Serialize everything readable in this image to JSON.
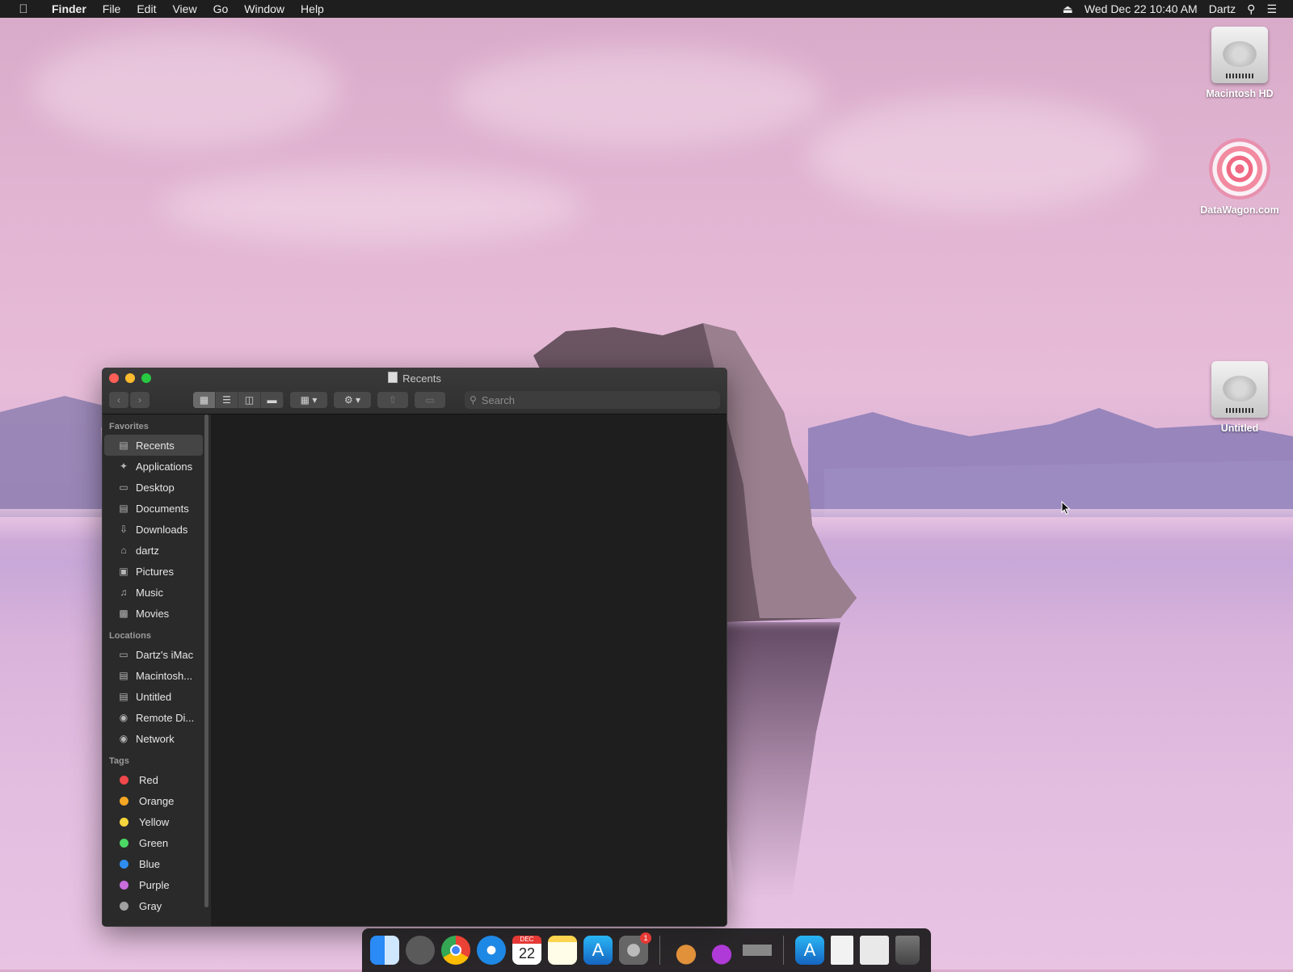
{
  "menubar": {
    "app": "Finder",
    "items": [
      "File",
      "Edit",
      "View",
      "Go",
      "Window",
      "Help"
    ],
    "datetime": "Wed Dec 22  10:40 AM",
    "user": "Dartz"
  },
  "desktop_icons": {
    "macintosh_hd": "Macintosh HD",
    "datawagon": "DataWagon.com",
    "untitled": "Untitled"
  },
  "window": {
    "title": "Recents",
    "search_placeholder": "Search"
  },
  "sidebar": {
    "favorites_header": "Favorites",
    "favorites": [
      {
        "label": "Recents",
        "icon": "recents-icon"
      },
      {
        "label": "Applications",
        "icon": "applications-icon"
      },
      {
        "label": "Desktop",
        "icon": "desktop-icon"
      },
      {
        "label": "Documents",
        "icon": "documents-icon"
      },
      {
        "label": "Downloads",
        "icon": "downloads-icon"
      },
      {
        "label": "dartz",
        "icon": "home-icon"
      },
      {
        "label": "Pictures",
        "icon": "pictures-icon"
      },
      {
        "label": "Music",
        "icon": "music-icon"
      },
      {
        "label": "Movies",
        "icon": "movies-icon"
      }
    ],
    "locations_header": "Locations",
    "locations": [
      {
        "label": "Dartz's iMac",
        "icon": "imac-icon"
      },
      {
        "label": "Macintosh...",
        "icon": "disk-icon"
      },
      {
        "label": "Untitled",
        "icon": "disk-icon"
      },
      {
        "label": "Remote Di...",
        "icon": "remote-disc-icon"
      },
      {
        "label": "Network",
        "icon": "network-icon"
      }
    ],
    "tags_header": "Tags",
    "tags": [
      {
        "label": "Red",
        "color": "#f0484a"
      },
      {
        "label": "Orange",
        "color": "#f5a623"
      },
      {
        "label": "Yellow",
        "color": "#f5d63d"
      },
      {
        "label": "Green",
        "color": "#4cd964"
      },
      {
        "label": "Blue",
        "color": "#2f8cf0"
      },
      {
        "label": "Purple",
        "color": "#c86ddd"
      },
      {
        "label": "Gray",
        "color": "#a0a0a0"
      }
    ]
  },
  "dock": {
    "apps": [
      "finder-icon",
      "launchpad-icon",
      "chrome-icon",
      "safari-icon",
      "calendar-icon",
      "notes-icon",
      "app-store-icon",
      "system-preferences-icon",
      "utility-app-icon",
      "utility-app-icon",
      "utility-app-icon",
      "app-store-icon",
      "document-icon",
      "document-icon",
      "trash-icon"
    ],
    "calendar_month": "DEC",
    "calendar_day": "22",
    "badge_count": "1"
  }
}
